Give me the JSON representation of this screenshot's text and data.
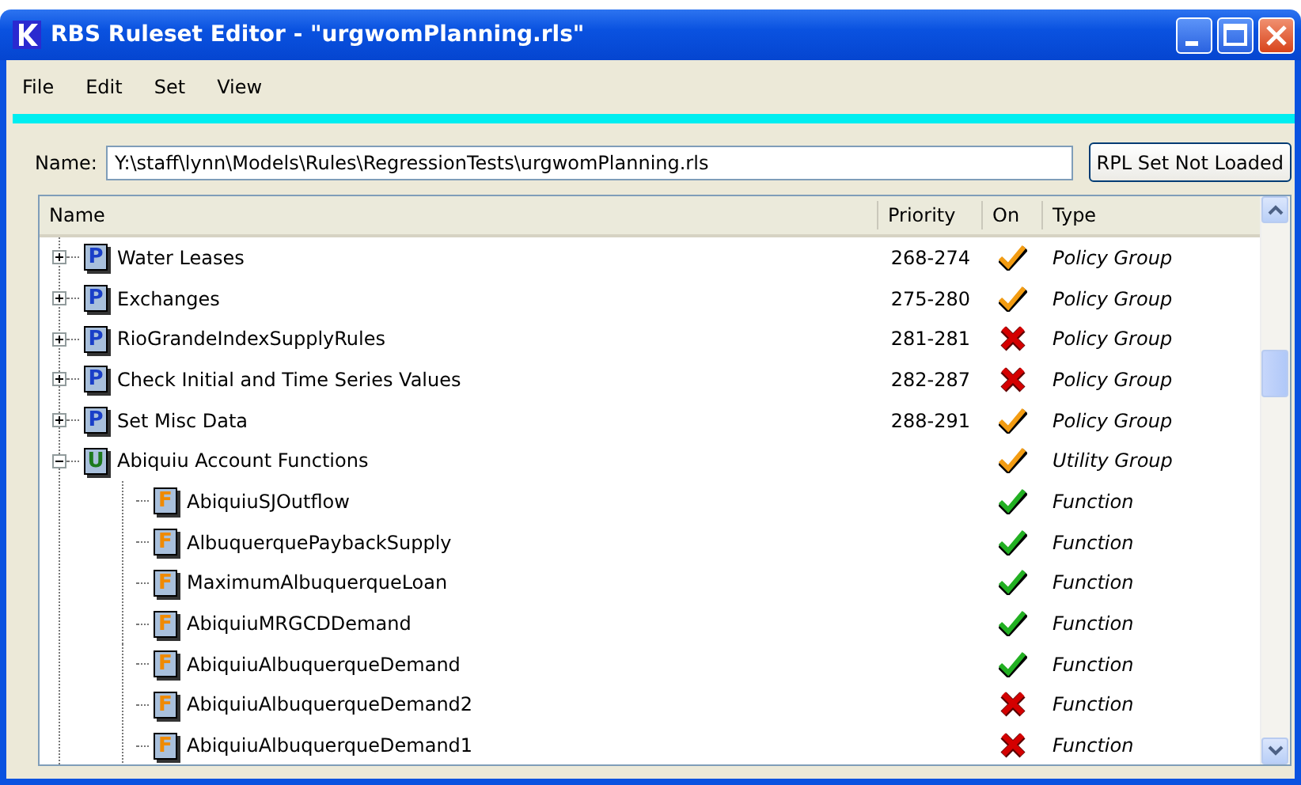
{
  "window": {
    "title": "RBS Ruleset Editor - \"urgwomPlanning.rls\""
  },
  "menu": [
    "File",
    "Edit",
    "Set",
    "View"
  ],
  "name_field": {
    "label": "Name:",
    "value": "Y:\\staff\\lynn\\Models\\Rules\\RegressionTests\\urgwomPlanning.rls"
  },
  "status_button": "RPL Set Not Loaded",
  "tree": {
    "columns": [
      "Name",
      "Priority",
      "On",
      "Type"
    ],
    "rows": [
      {
        "kind": "policy",
        "badge": "P",
        "name": "Water Leases",
        "priority": "268-274",
        "on": true,
        "type": "Policy Group",
        "expanded": false
      },
      {
        "kind": "policy",
        "badge": "P",
        "name": "Exchanges",
        "priority": "275-280",
        "on": true,
        "type": "Policy Group",
        "expanded": false
      },
      {
        "kind": "policy",
        "badge": "P",
        "name": "RioGrandeIndexSupplyRules",
        "priority": "281-281",
        "on": false,
        "type": "Policy Group",
        "expanded": false
      },
      {
        "kind": "policy",
        "badge": "P",
        "name": "Check Initial and Time Series Values",
        "priority": "282-287",
        "on": false,
        "type": "Policy Group",
        "expanded": false
      },
      {
        "kind": "policy",
        "badge": "P",
        "name": "Set Misc Data",
        "priority": "288-291",
        "on": true,
        "type": "Policy Group",
        "expanded": false
      },
      {
        "kind": "utility",
        "badge": "U",
        "name": "Abiquiu Account Functions",
        "on": true,
        "type": "Utility Group",
        "expanded": true,
        "children": [
          {
            "kind": "function",
            "badge": "F",
            "name": "AbiquiuSJOutflow",
            "on": true,
            "type": "Function"
          },
          {
            "kind": "function",
            "badge": "F",
            "name": "AlbuquerquePaybackSupply",
            "on": true,
            "type": "Function"
          },
          {
            "kind": "function",
            "badge": "F",
            "name": "MaximumAlbuquerqueLoan",
            "on": true,
            "type": "Function"
          },
          {
            "kind": "function",
            "badge": "F",
            "name": "AbiquiuMRGCDDemand",
            "on": true,
            "type": "Function"
          },
          {
            "kind": "function",
            "badge": "F",
            "name": "AbiquiuAlbuquerqueDemand",
            "on": true,
            "type": "Function"
          },
          {
            "kind": "function",
            "badge": "F",
            "name": "AbiquiuAlbuquerqueDemand2",
            "on": false,
            "type": "Function"
          },
          {
            "kind": "function",
            "badge": "F",
            "name": "AbiquiuAlbuquerqueDemand1",
            "on": false,
            "type": "Function"
          }
        ]
      }
    ]
  }
}
